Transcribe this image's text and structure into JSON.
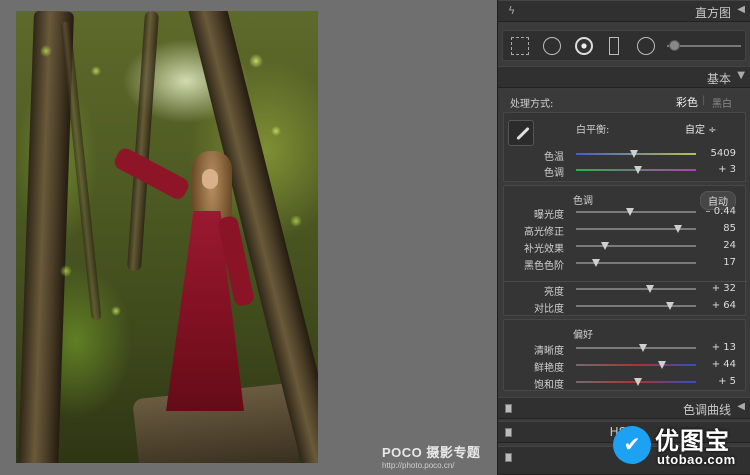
{
  "watermark": {
    "brand": "POCO 摄影专题",
    "url": "http://photo.poco.cn/"
  },
  "panel": {
    "histogram_title": "直方图",
    "basic_title": "基本",
    "treatment_label": "处理方式:",
    "treatment_options": [
      "彩色",
      "黑白"
    ],
    "wb_label": "白平衡:",
    "wb_value": "自定 ÷",
    "tone_label": "色调",
    "tone_auto": "自动",
    "presence_label": "偏好",
    "tone_curve_title": "色调曲线",
    "hsl_title": "HSL"
  },
  "sliders": {
    "wb": [
      {
        "label": "色温",
        "value": "5409",
        "pos": 0.48,
        "gradient": "linear-gradient(90deg,#3f5fd0,#b8c14a)"
      },
      {
        "label": "色调",
        "value": "+ 3",
        "pos": 0.52,
        "gradient": "linear-gradient(90deg,#2fb04a,#b040b0)"
      }
    ],
    "tone": [
      {
        "label": "曝光度",
        "value": "– 0.44",
        "pos": 0.45
      },
      {
        "label": "高光修正",
        "value": "85",
        "pos": 0.85
      },
      {
        "label": "补光效果",
        "value": "24",
        "pos": 0.24
      },
      {
        "label": "黑色色阶",
        "value": "17",
        "pos": 0.17
      }
    ],
    "tone2": [
      {
        "label": "亮度",
        "value": "+ 32",
        "pos": 0.62
      },
      {
        "label": "对比度",
        "value": "+ 64",
        "pos": 0.78
      }
    ],
    "presence": [
      {
        "label": "清晰度",
        "value": "+ 13",
        "pos": 0.56
      },
      {
        "label": "鲜艳度",
        "value": "+ 44",
        "pos": 0.72,
        "gradient": "linear-gradient(90deg,#6e6e6e,#b03030,#3050c0)"
      },
      {
        "label": "饱和度",
        "value": "+ 5",
        "pos": 0.52,
        "gradient": "linear-gradient(90deg,#6e6e6e,#b03030,#3050c0)"
      }
    ]
  },
  "logo": {
    "cn": "优图宝",
    "en": "utobao.com"
  }
}
